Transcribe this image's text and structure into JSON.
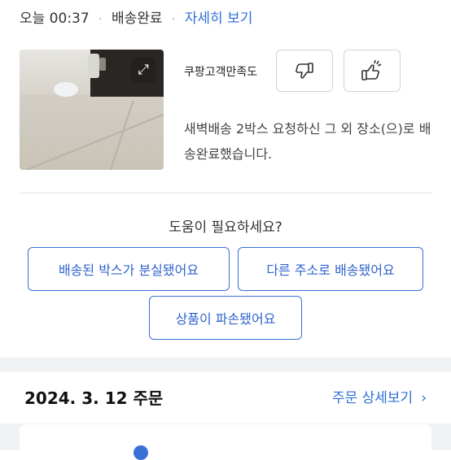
{
  "status": {
    "time": "오늘 00:37",
    "separator": "·",
    "delivery_status": "배송완료",
    "details_link": "자세히 보기"
  },
  "photo": {
    "expand_icon": "expand-icon",
    "expand_glyph": "⤢"
  },
  "feedback": {
    "label": "쿠팡고객만족도",
    "thumbs_down_icon": "thumbs-down-icon",
    "thumbs_up_icon": "thumbs-up-icon"
  },
  "message": "새벽배송 2박스 요청하신 그 외 장소(으)로 배송완료했습니다.",
  "help": {
    "question": "도움이 필요하세요?",
    "options": [
      "배송된 박스가 분실됐어요",
      "다른 주소로 배송됐어요",
      "상품이 파손됐어요"
    ]
  },
  "order": {
    "date": "2024. 3. 12 주문",
    "detail_link": "주문 상세보기",
    "chevron": "›"
  },
  "colors": {
    "accent": "#2f6fd6",
    "border_blue": "#3b6fd8",
    "gray_band": "#f1f2f4"
  }
}
